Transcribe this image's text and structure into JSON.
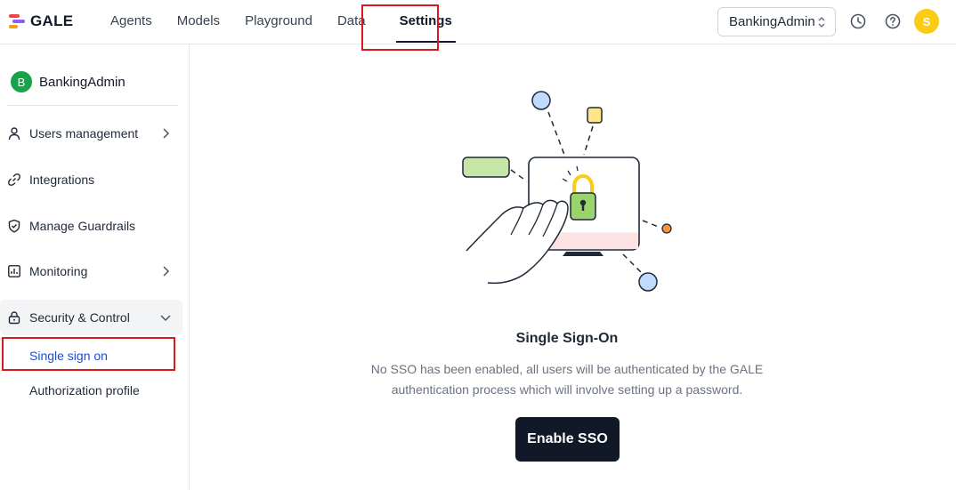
{
  "app": {
    "name": "GALE"
  },
  "nav": {
    "items": [
      {
        "label": "Agents"
      },
      {
        "label": "Models"
      },
      {
        "label": "Playground"
      },
      {
        "label": "Data"
      },
      {
        "label": "Settings",
        "active": true
      }
    ]
  },
  "header": {
    "org_select": {
      "value": "BankingAdmin"
    },
    "user_avatar": "S",
    "icons": [
      "history-icon",
      "help-icon"
    ]
  },
  "sidebar": {
    "workspace": {
      "avatar": "B",
      "name": "BankingAdmin"
    },
    "items": [
      {
        "label": "Users management",
        "icon": "user-icon",
        "has_chevron": true
      },
      {
        "label": "Integrations",
        "icon": "link-icon",
        "has_chevron": false
      },
      {
        "label": "Manage Guardrails",
        "icon": "shield-check-icon",
        "has_chevron": false
      },
      {
        "label": "Monitoring",
        "icon": "chart-icon",
        "has_chevron": true
      },
      {
        "label": "Security & Control",
        "icon": "lock-icon",
        "has_chevron": true,
        "expanded": true
      }
    ],
    "sub_items": [
      {
        "label": "Single sign on",
        "active": true
      },
      {
        "label": "Authorization profile"
      }
    ]
  },
  "main": {
    "title": "Single Sign-On",
    "description_line1": "No SSO has been enabled, all users will be authenticated by the GALE",
    "description_line2": "authentication process which will involve setting up a password.",
    "button_label": "Enable SSO"
  },
  "colors": {
    "accent_active": "#1d4ed8",
    "highlight_red": "#d71920",
    "button_dark": "#111827",
    "avatar_yellow": "#facc15",
    "workspace_green": "#16a34a"
  }
}
